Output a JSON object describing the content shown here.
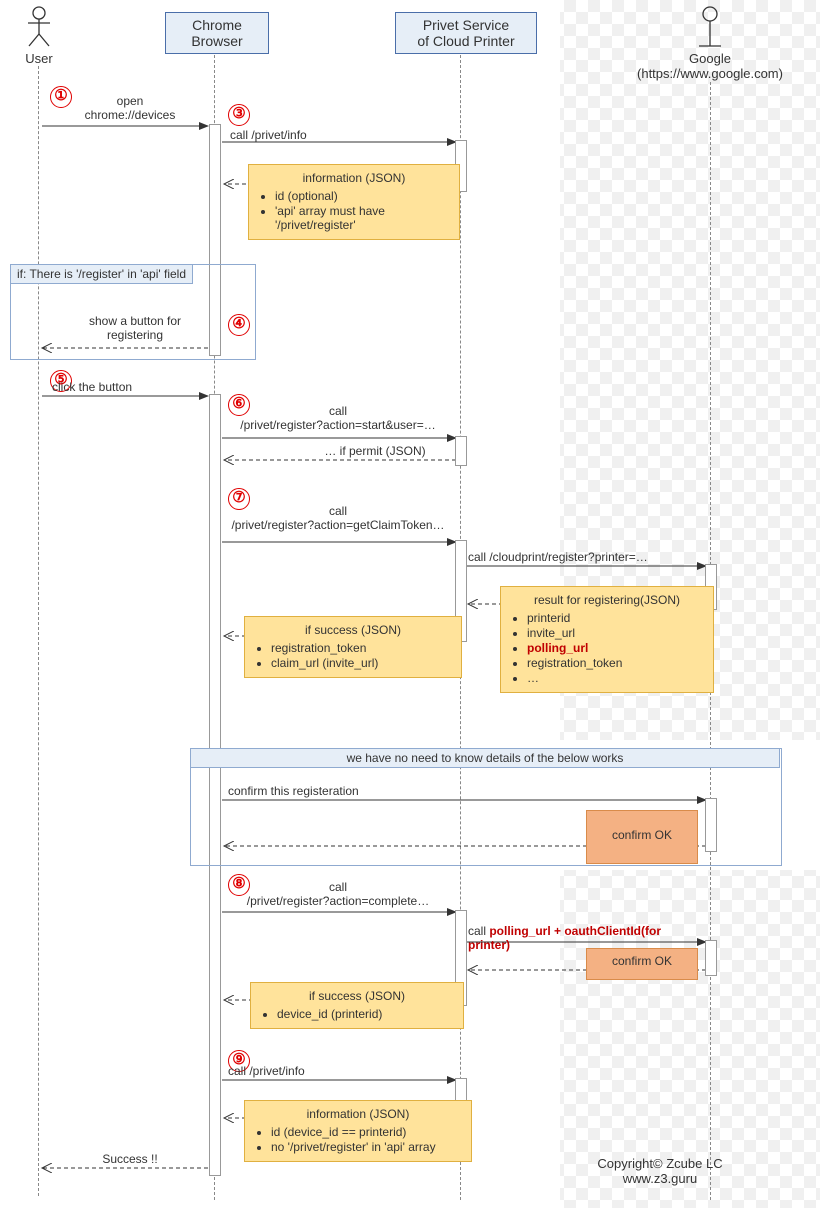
{
  "actors": {
    "user": "User",
    "chrome": "Chrome\nBrowser",
    "privet": "Privet Service\nof Cloud Printer",
    "google": "Google\n(https://www.google.com)"
  },
  "steps": {
    "s1": "①",
    "s3": "③",
    "s4": "④",
    "s5": "⑤",
    "s6": "⑥",
    "s7": "⑦",
    "s8": "⑧",
    "s9": "⑨"
  },
  "msgs": {
    "open_devices": "open\nchrome://devices",
    "call_info1": "call /privet/info",
    "info_json1_title": "information (JSON)",
    "info_json1_items": [
      "id (optional)",
      "'api' array must have '/privet/register'"
    ],
    "frag_if": "if: There is '/register' in 'api' field",
    "show_button": "show a button for\nregistering",
    "click_button": "click the button",
    "call_start": "call\n/privet/register?action=start&user=…",
    "if_permit": "… if permit (JSON)",
    "call_claim": "call\n/privet/register?action=getClaimToken…",
    "call_cloud_register": "call /cloudprint/register?printer=…",
    "result_reg_title": "result for registering(JSON)",
    "result_reg_items": [
      "printerid",
      "invite_url",
      "polling_url",
      "registration_token",
      "…"
    ],
    "if_success1_title": "if success (JSON)",
    "if_success1_items": [
      "registration_token",
      "claim_url (invite_url)"
    ],
    "noneed": "we have no need to know details of the below works",
    "confirm_reg": "confirm this registeration",
    "confirm_ok1": "confirm OK",
    "call_complete": "call\n/privet/register?action=complete…",
    "call_polling_pre": "call ",
    "call_polling_red": "polling_url + oauthClientId(for printer)",
    "confirm_ok2": "confirm OK",
    "if_success2_title": "if success (JSON)",
    "if_success2_items": [
      "device_id (printerid)"
    ],
    "call_info2": "call /privet/info",
    "info_json2_title": "information (JSON)",
    "info_json2_items": [
      "id (device_id == printerid)",
      "no '/privet/register' in 'api' array"
    ],
    "success": "Success !!"
  },
  "copyright": {
    "line1": "Copyright© Zcube LC",
    "line2": "www.z3.guru"
  }
}
